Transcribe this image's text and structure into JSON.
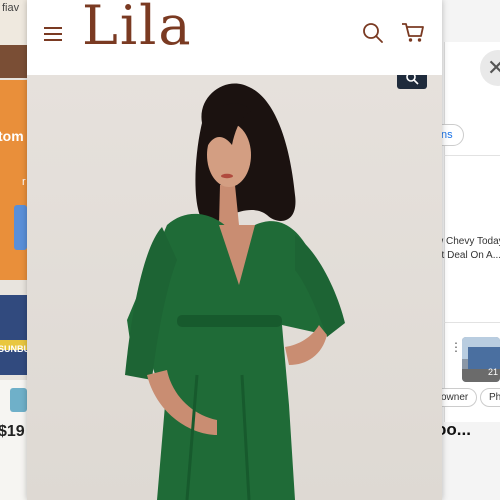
{
  "left_app": {
    "top_text": "fiav",
    "promo_text": "tom",
    "small_text": "r",
    "poster_text": "SUNBU",
    "price": "$19"
  },
  "right_app": {
    "chip_label": "ns",
    "item_line_1": "w Chevy Today",
    "item_line_2": "at Deal On A...",
    "thumb_badge": "21",
    "chip_owner": "owner",
    "chip_pho": "Pho",
    "bottom_text": "oo..."
  },
  "header": {
    "logo": "Lila",
    "brand_color": "#7a3a22"
  },
  "icons": {
    "menu": "menu-icon",
    "search": "search-icon",
    "cart": "cart-icon",
    "zoom": "zoom-icon",
    "close": "close-icon"
  },
  "product_image": {
    "description_alt": "green wrap maternity dress"
  }
}
